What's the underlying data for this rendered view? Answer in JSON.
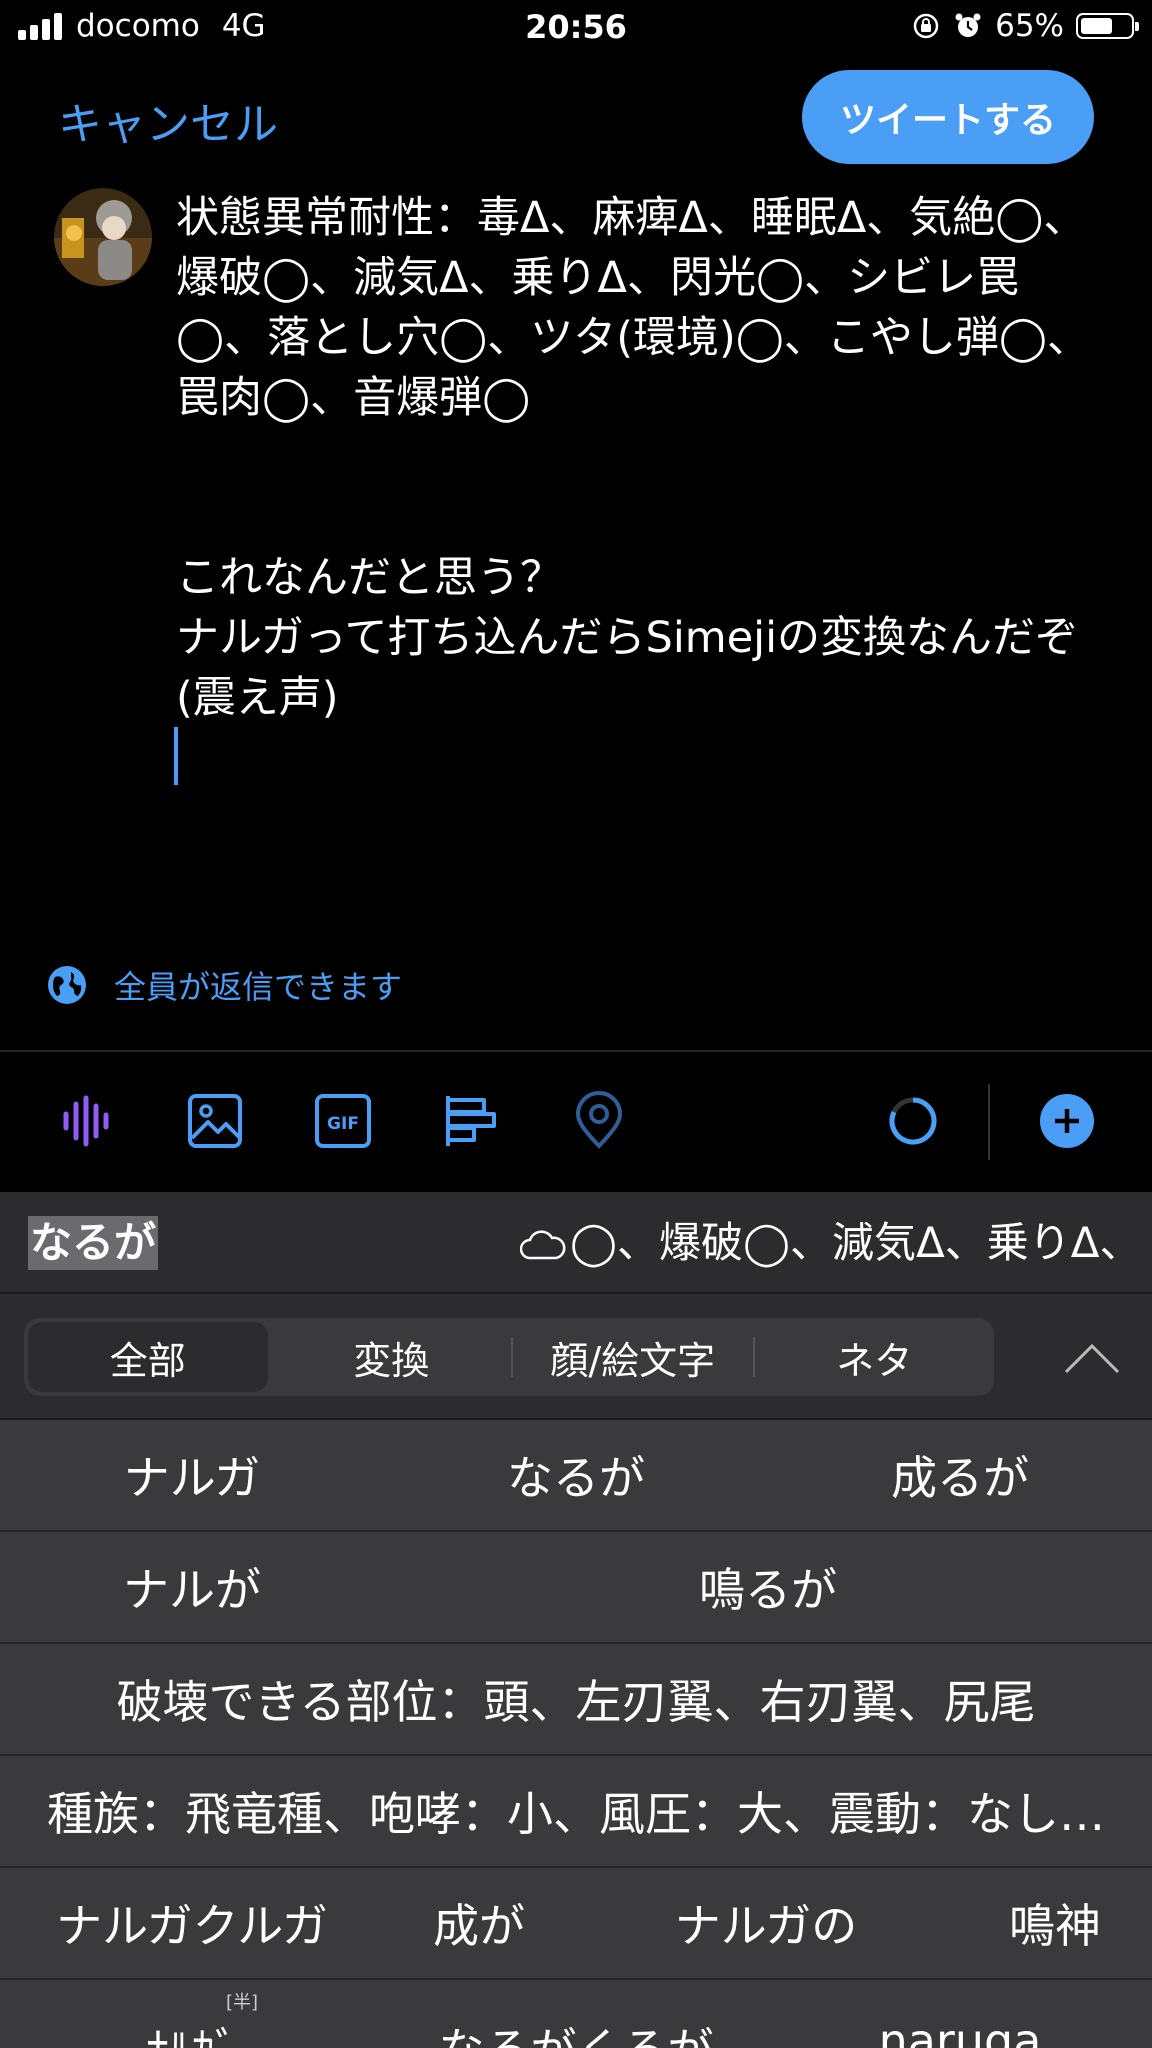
{
  "status_bar": {
    "carrier": "docomo",
    "network": "4G",
    "time": "20:56",
    "battery": "65%",
    "battery_level": 0.65,
    "icons": [
      "signal-icon",
      "orientation-lock-icon",
      "alarm-icon",
      "battery-icon"
    ]
  },
  "header": {
    "cancel_label": "キャンセル",
    "tweet_label": "ツイートする"
  },
  "compose": {
    "text": "状態異常耐性：毒Δ、麻痺Δ、睡眠Δ、気絶◯、爆破◯、減気Δ、乗りΔ、閃光◯、シビレ罠◯、落とし穴◯、ツタ(環境)◯、こやし弾◯、罠肉◯、音爆弾◯\n\n\nこれなんだと思う？\nナルガって打ち込んだらSimejiの変換なんだぞ(震え声)"
  },
  "reply_setting": {
    "label": "全員が返信できます",
    "icon": "globe-icon"
  },
  "toolbar": {
    "icons": [
      "voice-tweet-icon",
      "image-icon",
      "gif-icon",
      "poll-icon",
      "location-icon",
      "character-count-icon",
      "add-tweet-icon"
    ],
    "gif_text": "GIF",
    "accent_color": "#4a9ef5",
    "voice_color": "#8f5cf5"
  },
  "keyboard": {
    "composing_text": "なるが",
    "prediction_preview": "◯、爆破◯、減気Δ、乗りΔ、",
    "tabs": [
      {
        "label": "全部",
        "active": true
      },
      {
        "label": "変換",
        "active": false
      },
      {
        "label": "顔/絵文字",
        "active": false
      },
      {
        "label": "ネタ",
        "active": false
      }
    ],
    "candidates": [
      [
        "ナルガ",
        "なるが",
        "成るが"
      ],
      [
        "ナルが",
        "鳴るが"
      ],
      [
        "破壊できる部位：頭、左刃翼、右刃翼、尻尾"
      ],
      [
        "種族：飛竜種、咆哮：小、風圧：大、震動：なし…"
      ],
      [
        "ナルガクルガ",
        "成が",
        "ナルガの",
        "鳴神"
      ],
      [
        "ﾅﾙｶﾞ",
        "なるがくるが",
        "naruga"
      ]
    ],
    "half_width_tag": "[半]"
  }
}
